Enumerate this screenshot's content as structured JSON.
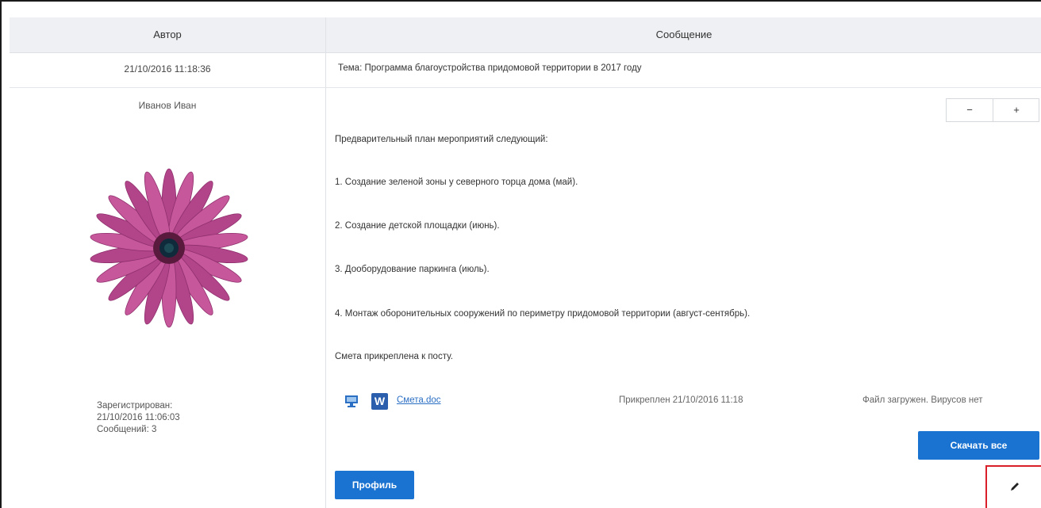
{
  "table": {
    "header_author": "Автор",
    "header_message": "Сообщение"
  },
  "post": {
    "date": "21/10/2016 11:18:36",
    "topic": "Тема: Программа благоустройства придомовой территории в 2017 году",
    "author_name": "Иванов Иван",
    "registered_label": "Зарегистрирован:",
    "registered_date": "21/10/2016 11:06:03",
    "messages_count": "Сообщений: 3",
    "lines": [
      "Предварительный план мероприятий следующий:",
      "1. Создание зеленой зоны у северного торца дома (май).",
      "2. Создание детской площадки (июнь).",
      "3. Дооборудование паркинга (июль).",
      "4. Монтаж оборонительных сооружений по периметру придомовой территории (август-сентябрь).",
      "Смета прикреплена к посту."
    ],
    "attachment": {
      "file_name": "Смета.doc",
      "attached_text": "Прикреплен 21/10/2016 11:18",
      "virus_text": "Файл загружен. Вирусов нет"
    }
  },
  "buttons": {
    "minus": "−",
    "plus": "+",
    "download_all": "Скачать все",
    "profile": "Профиль"
  },
  "icons": {
    "edit": "pencil-icon",
    "monitor": "monitor-icon",
    "word": "word-file-icon"
  },
  "colors": {
    "accent": "#1a73d0",
    "header_bg": "#eef0f3",
    "link": "#2b6fc4",
    "highlight": "#d9202a"
  },
  "word_glyph": "W"
}
